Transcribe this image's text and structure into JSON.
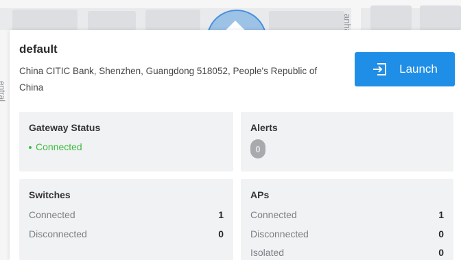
{
  "map": {
    "street_labels": [
      "anha",
      "entral"
    ]
  },
  "site": {
    "name": "default",
    "address": "China CITIC Bank, Shenzhen, Guangdong 518052, People's Republic of China",
    "launch_label": "Launch"
  },
  "gateway": {
    "title": "Gateway Status",
    "status": "Connected",
    "status_color": "#3dbb3d"
  },
  "alerts": {
    "title": "Alerts",
    "count": "0"
  },
  "switches": {
    "title": "Switches",
    "rows": [
      {
        "label": "Connected",
        "value": "1"
      },
      {
        "label": "Disconnected",
        "value": "0"
      }
    ]
  },
  "aps": {
    "title": "APs",
    "rows": [
      {
        "label": "Connected",
        "value": "1"
      },
      {
        "label": "Disconnected",
        "value": "0"
      },
      {
        "label": "Isolated",
        "value": "0"
      }
    ]
  },
  "colors": {
    "accent": "#1f8ee6",
    "tile_bg": "#f1f2f4"
  }
}
